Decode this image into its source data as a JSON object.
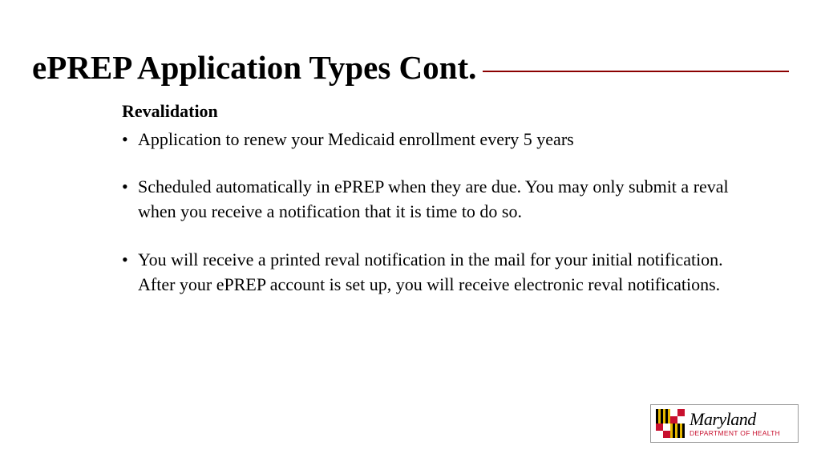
{
  "title": "ePREP Application Types Cont.",
  "subtitle": "Revalidation",
  "bullets": [
    "Application to renew your Medicaid enrollment every 5 years",
    "Scheduled automatically in ePREP when they are due. You may only submit a reval when you receive a notification that it is time to do so.",
    "You will receive a printed reval notification in the mail for your initial notification. After your ePREP account is set up, you will receive electronic reval notifications."
  ],
  "logo": {
    "main": "Maryland",
    "sub": "DEPARTMENT OF HEALTH"
  }
}
